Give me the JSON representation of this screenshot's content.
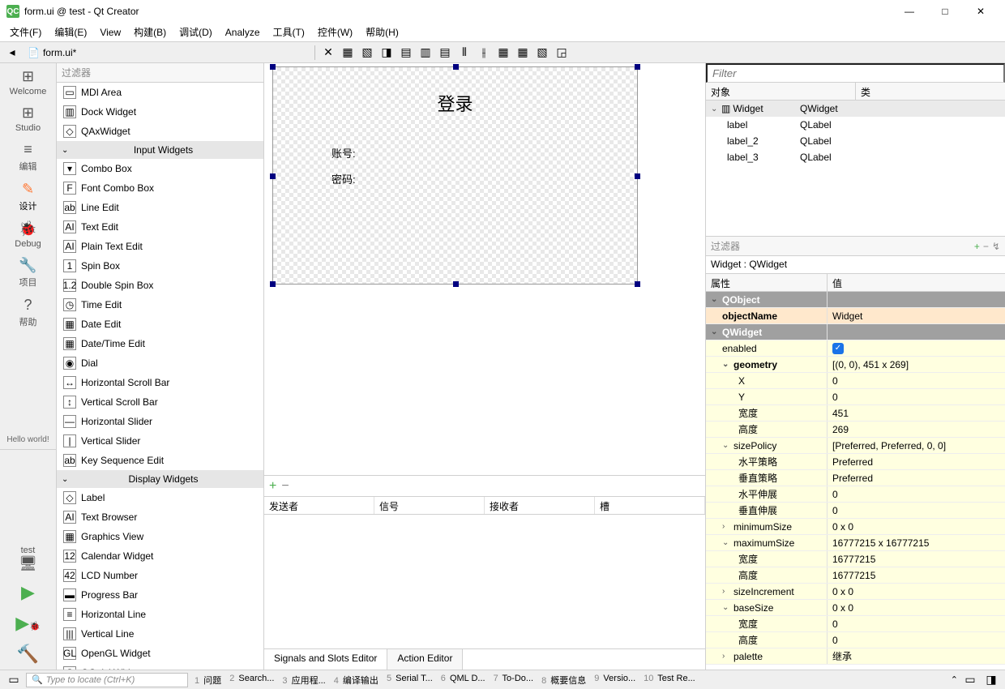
{
  "title": "form.ui @ test - Qt Creator",
  "app_icon": "QC",
  "menubar": [
    "文件(F)",
    "编辑(E)",
    "View",
    "构建(B)",
    "调试(D)",
    "Analyze",
    "工具(T)",
    "控件(W)",
    "帮助(H)"
  ],
  "toolbar_file": "form.ui*",
  "leftbar": [
    {
      "icon": "⊞",
      "label": "Welcome"
    },
    {
      "icon": "⊞",
      "label": "Studio"
    },
    {
      "icon": "≡",
      "label": "编辑"
    },
    {
      "icon": "✎",
      "label": "设计",
      "active": true
    },
    {
      "icon": "🐞",
      "label": "Debug"
    },
    {
      "icon": "🔧",
      "label": "项目"
    },
    {
      "icon": "?",
      "label": "帮助"
    }
  ],
  "leftbar_hello": "Hello world!",
  "leftbar_kit": "test",
  "widgetbox_filter": "过滤器",
  "widget_items": [
    {
      "type": "item",
      "icon": "▭",
      "label": "MDI Area"
    },
    {
      "type": "item",
      "icon": "▥",
      "label": "Dock Widget"
    },
    {
      "type": "item",
      "icon": "◇",
      "label": "QAxWidget"
    },
    {
      "type": "cat",
      "label": "Input Widgets"
    },
    {
      "type": "item",
      "icon": "▾",
      "label": "Combo Box"
    },
    {
      "type": "item",
      "icon": "F",
      "label": "Font Combo Box"
    },
    {
      "type": "item",
      "icon": "ab",
      "label": "Line Edit"
    },
    {
      "type": "item",
      "icon": "AI",
      "label": "Text Edit"
    },
    {
      "type": "item",
      "icon": "AI",
      "label": "Plain Text Edit"
    },
    {
      "type": "item",
      "icon": "1",
      "label": "Spin Box"
    },
    {
      "type": "item",
      "icon": "1.2",
      "label": "Double Spin Box"
    },
    {
      "type": "item",
      "icon": "◷",
      "label": "Time Edit"
    },
    {
      "type": "item",
      "icon": "▦",
      "label": "Date Edit"
    },
    {
      "type": "item",
      "icon": "▦",
      "label": "Date/Time Edit"
    },
    {
      "type": "item",
      "icon": "◉",
      "label": "Dial"
    },
    {
      "type": "item",
      "icon": "↔",
      "label": "Horizontal Scroll Bar"
    },
    {
      "type": "item",
      "icon": "↕",
      "label": "Vertical Scroll Bar"
    },
    {
      "type": "item",
      "icon": "—",
      "label": "Horizontal Slider"
    },
    {
      "type": "item",
      "icon": "|",
      "label": "Vertical Slider"
    },
    {
      "type": "item",
      "icon": "ab",
      "label": "Key Sequence Edit"
    },
    {
      "type": "cat",
      "label": "Display Widgets"
    },
    {
      "type": "item",
      "icon": "◇",
      "label": "Label"
    },
    {
      "type": "item",
      "icon": "AI",
      "label": "Text Browser"
    },
    {
      "type": "item",
      "icon": "▦",
      "label": "Graphics View"
    },
    {
      "type": "item",
      "icon": "12",
      "label": "Calendar Widget"
    },
    {
      "type": "item",
      "icon": "42",
      "label": "LCD Number"
    },
    {
      "type": "item",
      "icon": "▬",
      "label": "Progress Bar"
    },
    {
      "type": "item",
      "icon": "≡",
      "label": "Horizontal Line"
    },
    {
      "type": "item",
      "icon": "|||",
      "label": "Vertical Line"
    },
    {
      "type": "item",
      "icon": "GL",
      "label": "OpenGL Widget"
    },
    {
      "type": "item",
      "icon": "Q",
      "label": "QQuickWidget"
    }
  ],
  "form": {
    "title_label": "登录",
    "field1": "账号:",
    "field2": "密码:"
  },
  "signals": {
    "columns": [
      "发送者",
      "信号",
      "接收者",
      "槽"
    ],
    "tabs": [
      "Signals and Slots Editor",
      "Action Editor"
    ]
  },
  "obj_filter": "Filter",
  "obj_columns": [
    "对象",
    "类"
  ],
  "obj_tree": [
    {
      "name": "Widget",
      "class": "QWidget",
      "indent": 0,
      "expanded": true,
      "sel": true,
      "icon": "▥"
    },
    {
      "name": "label",
      "class": "QLabel",
      "indent": 1
    },
    {
      "name": "label_2",
      "class": "QLabel",
      "indent": 1
    },
    {
      "name": "label_3",
      "class": "QLabel",
      "indent": 1
    }
  ],
  "prop_filter": "过滤器",
  "prop_title": "Widget : QWidget",
  "prop_columns": [
    "属性",
    "值"
  ],
  "props": [
    {
      "group": "QObject"
    },
    {
      "name": "objectName",
      "val": "Widget",
      "cls": "pr-orange bold"
    },
    {
      "group": "QWidget"
    },
    {
      "name": "enabled",
      "val": "☑",
      "cls": "pr-yellow",
      "check": true
    },
    {
      "name": "geometry",
      "val": "[(0, 0), 451 x 269]",
      "cls": "pr-yellow bold",
      "exp": "⌄"
    },
    {
      "name": "X",
      "val": "0",
      "cls": "pr-yellow sub"
    },
    {
      "name": "Y",
      "val": "0",
      "cls": "pr-yellow sub"
    },
    {
      "name": "宽度",
      "val": "451",
      "cls": "pr-yellow sub"
    },
    {
      "name": "高度",
      "val": "269",
      "cls": "pr-yellow sub"
    },
    {
      "name": "sizePolicy",
      "val": "[Preferred, Preferred, 0, 0]",
      "cls": "pr-yellow",
      "exp": "⌄"
    },
    {
      "name": "水平策略",
      "val": "Preferred",
      "cls": "pr-yellow sub"
    },
    {
      "name": "垂直策略",
      "val": "Preferred",
      "cls": "pr-yellow sub"
    },
    {
      "name": "水平伸展",
      "val": "0",
      "cls": "pr-yellow sub"
    },
    {
      "name": "垂直伸展",
      "val": "0",
      "cls": "pr-yellow sub"
    },
    {
      "name": "minimumSize",
      "val": "0 x 0",
      "cls": "pr-yellow",
      "exp": "›"
    },
    {
      "name": "maximumSize",
      "val": "16777215 x 16777215",
      "cls": "pr-yellow",
      "exp": "⌄"
    },
    {
      "name": "宽度",
      "val": "16777215",
      "cls": "pr-yellow sub"
    },
    {
      "name": "高度",
      "val": "16777215",
      "cls": "pr-yellow sub"
    },
    {
      "name": "sizeIncrement",
      "val": "0 x 0",
      "cls": "pr-yellow",
      "exp": "›"
    },
    {
      "name": "baseSize",
      "val": "0 x 0",
      "cls": "pr-yellow",
      "exp": "⌄"
    },
    {
      "name": "宽度",
      "val": "0",
      "cls": "pr-yellow sub"
    },
    {
      "name": "高度",
      "val": "0",
      "cls": "pr-yellow sub"
    },
    {
      "name": "palette",
      "val": "继承",
      "cls": "pr-yellow",
      "exp": "›"
    }
  ],
  "statusbar": {
    "locator_placeholder": "Type to locate (Ctrl+K)",
    "items": [
      {
        "n": "1",
        "t": "问题"
      },
      {
        "n": "2",
        "t": "Search..."
      },
      {
        "n": "3",
        "t": "应用程..."
      },
      {
        "n": "4",
        "t": "编译输出"
      },
      {
        "n": "5",
        "t": "Serial T..."
      },
      {
        "n": "6",
        "t": "QML D..."
      },
      {
        "n": "7",
        "t": "To-Do..."
      },
      {
        "n": "8",
        "t": "概要信息"
      },
      {
        "n": "9",
        "t": "Versio..."
      },
      {
        "n": "10",
        "t": "Test Re..."
      }
    ]
  }
}
